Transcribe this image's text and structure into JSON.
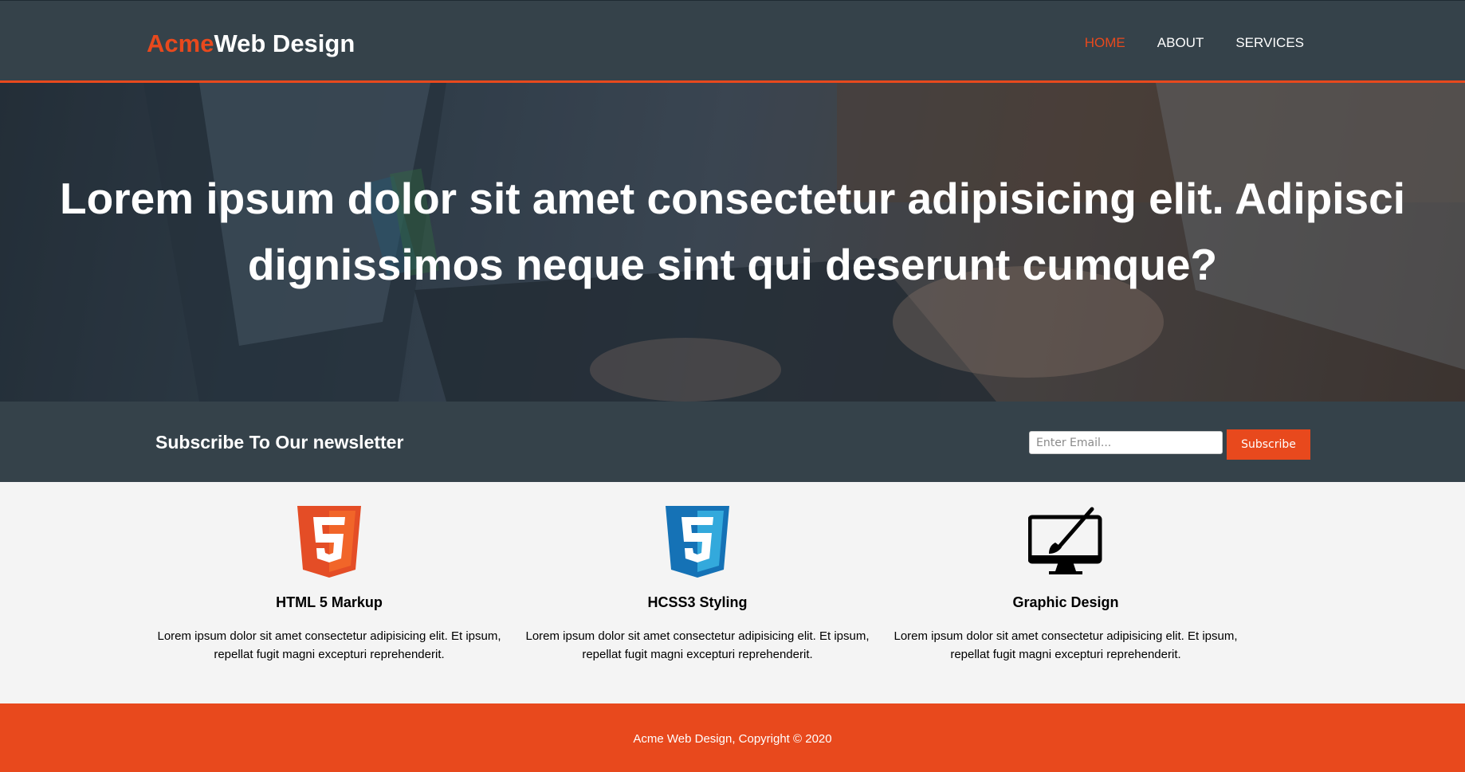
{
  "header": {
    "brand_highlight": "Acme",
    "brand_rest": "Web Design",
    "nav": [
      {
        "label": "HOME",
        "current": true
      },
      {
        "label": "ABOUT",
        "current": false
      },
      {
        "label": "SERVICES",
        "current": false
      }
    ]
  },
  "showcase": {
    "title": "Lorem ipsum dolor sit amet consectetur adipisicing elit. Adipisci dignissimos neque sint qui deserunt cumque?"
  },
  "newsletter": {
    "title": "Subscribe To Our newsletter",
    "email_placeholder": "Enter Email...",
    "button_label": "Subscribe"
  },
  "boxes": [
    {
      "icon": "html5-icon",
      "title": "HTML 5 Markup",
      "text": "Lorem ipsum dolor sit amet consectetur adipisicing elit. Et ipsum, repellat fugit magni excepturi reprehenderit."
    },
    {
      "icon": "css3-icon",
      "title": "HCSS3 Styling",
      "text": "Lorem ipsum dolor sit amet consectetur adipisicing elit. Et ipsum, repellat fugit magni excepturi reprehenderit."
    },
    {
      "icon": "graphic-design-icon",
      "title": "Graphic Design",
      "text": "Lorem ipsum dolor sit amet consectetur adipisicing elit. Et ipsum, repellat fugit magni excepturi reprehenderit."
    }
  ],
  "footer": {
    "text": "Acme Web Design, Copyright © 2020"
  },
  "colors": {
    "accent": "#e8491d",
    "dark": "#35424a",
    "light_bg": "#f4f4f4",
    "css_blue": "#1572b6",
    "html_orange": "#e44d26"
  }
}
